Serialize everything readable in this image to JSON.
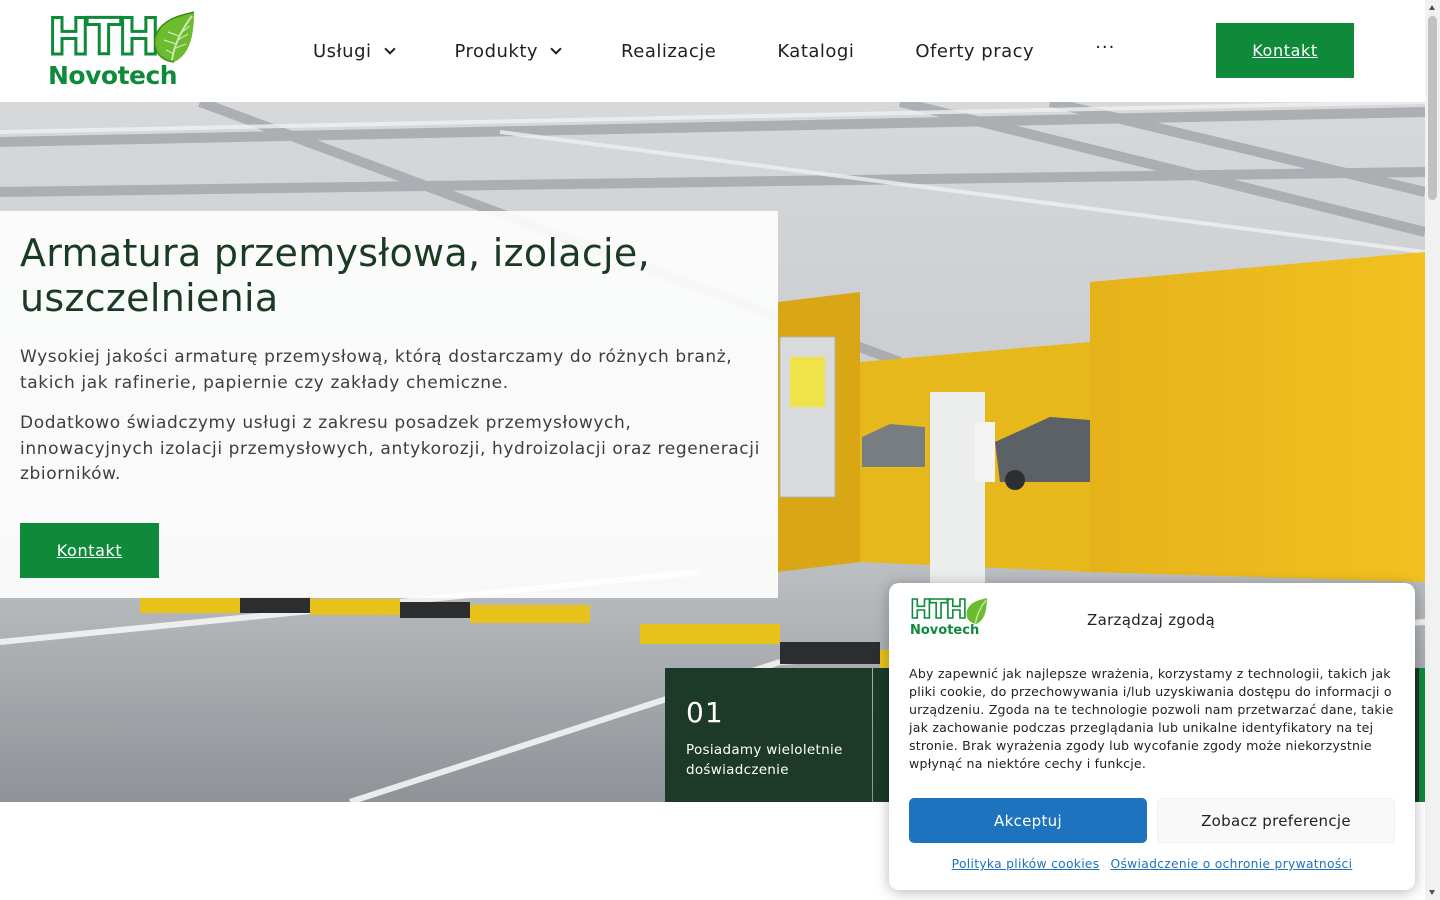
{
  "brand": {
    "logo_letters": "HTH",
    "logo_name": "Novotech",
    "green": "#0e8a3a",
    "dark_green": "#1c3a27",
    "blue": "#1e73be"
  },
  "nav": {
    "items": [
      {
        "label": "Usługi",
        "has_dropdown": true
      },
      {
        "label": "Produkty",
        "has_dropdown": true
      },
      {
        "label": "Realizacje",
        "has_dropdown": false
      },
      {
        "label": "Katalogi",
        "has_dropdown": false
      },
      {
        "label": "Oferty pracy",
        "has_dropdown": false
      }
    ],
    "more_label": "···",
    "cta_label": "Kontakt"
  },
  "hero": {
    "title": "Armatura przemysłowa, izolacje, uszczelnienia",
    "paragraph1": "Wysokiej jakości armaturę przemysłową, którą dostarczamy do różnych branż, takich jak rafinerie, papiernie czy zakłady chemiczne.",
    "paragraph2": "Dodatkowo świadczymy usługi z zakresu posadzek przemysłowych, innowacyjnych izolacji przemysłowych, antykorozji, hydroizolacji oraz regeneracji zbiorników.",
    "cta_label": "Kontakt",
    "stats": [
      {
        "number": "01",
        "label": "Posiadamy wieloletnie doświadczenie"
      }
    ]
  },
  "cookie": {
    "title": "Zarządzaj zgodą",
    "text": "Aby zapewnić jak najlepsze wrażenia, korzystamy z technologii, takich jak pliki cookie, do przechowywania i/lub uzyskiwania dostępu do informacji o urządzeniu. Zgoda na te technologie pozwoli nam przetwarzać dane, takie jak zachowanie podczas przeglądania lub unikalne identyfikatory na tej stronie. Brak wyrażenia zgody lub wycofanie zgody może niekorzystnie wpłynąć na niektóre cechy i funkcje.",
    "accept_label": "Akceptuj",
    "preferences_label": "Zobacz preferencje",
    "link_cookies": "Polityka plików cookies",
    "link_privacy": "Oświadczenie o ochronie prywatności"
  }
}
